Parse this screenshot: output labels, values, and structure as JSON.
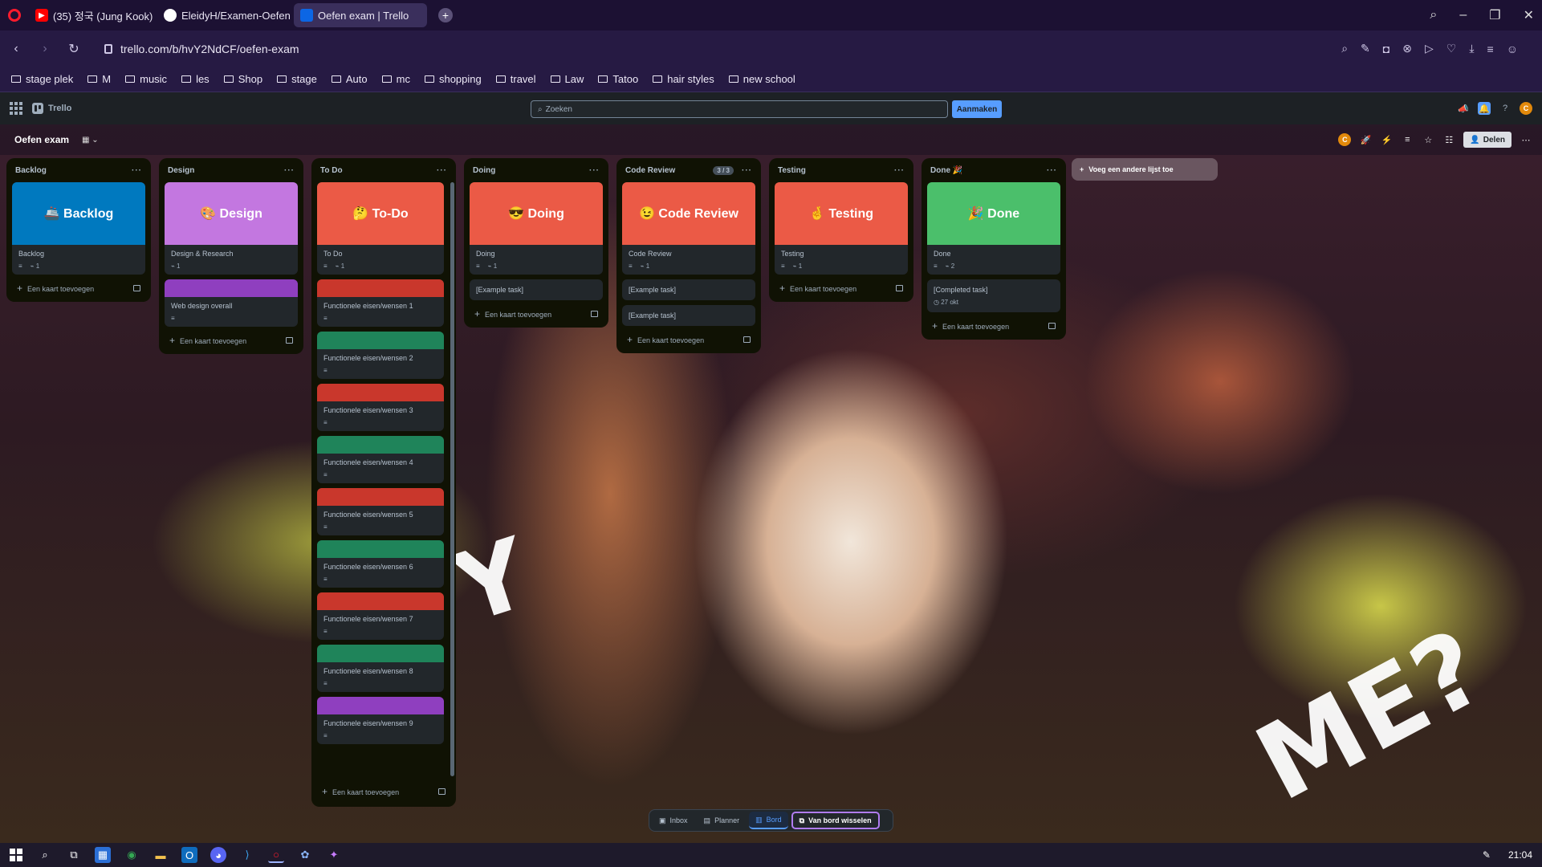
{
  "browser": {
    "tabs": [
      {
        "title": "(35) 정국 (Jung Kook)",
        "favicon": "youtube-icon"
      },
      {
        "title": "EleidyH/Examen-OefenOp",
        "favicon": "github-icon"
      },
      {
        "title": "Oefen exam | Trello",
        "favicon": "trello-icon",
        "active": true
      }
    ],
    "url": "trello.com/b/hvY2NdCF/oefen-exam",
    "bookmarks": [
      "stage plek",
      "M",
      "music",
      "les",
      "Shop",
      "stage",
      "Auto",
      "mc",
      "shopping",
      "travel",
      "Law",
      "Tatoo",
      "hair styles",
      "new school"
    ]
  },
  "trello": {
    "logo_text": "Trello",
    "search_placeholder": "Zoeken",
    "create_label": "Aanmaken",
    "avatar_initial": "C",
    "board_title": "Oefen exam",
    "share_label": "Delen",
    "add_list_label": "Voeg een andere lijst toe",
    "add_card_label": "Een kaart toevoegen"
  },
  "lists": [
    {
      "name": "Backlog",
      "cover_title": "🚢 Backlog",
      "cover_color": "#0079bf",
      "card_title": "Backlog",
      "attachments": "1"
    },
    {
      "name": "Design",
      "cover_title": "🎨 Design",
      "cover_color": "#c377e0",
      "card_title": "Design & Research",
      "attachments": "1",
      "extra_card": "Web design overall",
      "extra_color": "#8f3fbf"
    },
    {
      "name": "To Do",
      "cover_title": "🤔 To-Do",
      "cover_color": "#eb5a46",
      "card_title": "To Do",
      "attachments": "1"
    },
    {
      "name": "Doing",
      "cover_title": "😎 Doing",
      "cover_color": "#eb5a46",
      "card_title": "Doing",
      "attachments": "1",
      "task": "[Example task]"
    },
    {
      "name": "Code Review",
      "count": "3 / 3",
      "cover_title": "😉 Code Review",
      "cover_color": "#eb5a46",
      "card_title": "Code Review",
      "attachments": "1",
      "task": "[Example task]",
      "task2": "[Example task]"
    },
    {
      "name": "Testing",
      "cover_title": "🤞 Testing",
      "cover_color": "#eb5a46",
      "card_title": "Testing",
      "attachments": "1"
    },
    {
      "name": "Done 🎉",
      "cover_title": "🎉 Done",
      "cover_color": "#4bbf6b",
      "card_title": "Done",
      "attachments": "2",
      "task": "[Completed task]",
      "due": "27 okt"
    }
  ],
  "todo_cards": [
    {
      "title": "Functionele eisen/wensen 1",
      "color": "#c9372c"
    },
    {
      "title": "Functionele eisen/wensen 2",
      "color": "#1f845a"
    },
    {
      "title": "Functionele eisen/wensen 3",
      "color": "#c9372c"
    },
    {
      "title": "Functionele eisen/wensen 4",
      "color": "#1f845a"
    },
    {
      "title": "Functionele eisen/wensen 5",
      "color": "#c9372c"
    },
    {
      "title": "Functionele eisen/wensen 6",
      "color": "#1f845a"
    },
    {
      "title": "Functionele eisen/wensen 7",
      "color": "#c9372c"
    },
    {
      "title": "Functionele eisen/wensen 8",
      "color": "#1f845a"
    },
    {
      "title": "Functionele eisen/wensen 9",
      "color": "#8f3fbf"
    }
  ],
  "switcher": {
    "inbox": "Inbox",
    "planner": "Planner",
    "board": "Bord",
    "switch_board": "Van bord wisselen"
  },
  "wallpaper_text": {
    "left": "Y",
    "right": "ME?"
  },
  "taskbar": {
    "time": "21:04"
  }
}
